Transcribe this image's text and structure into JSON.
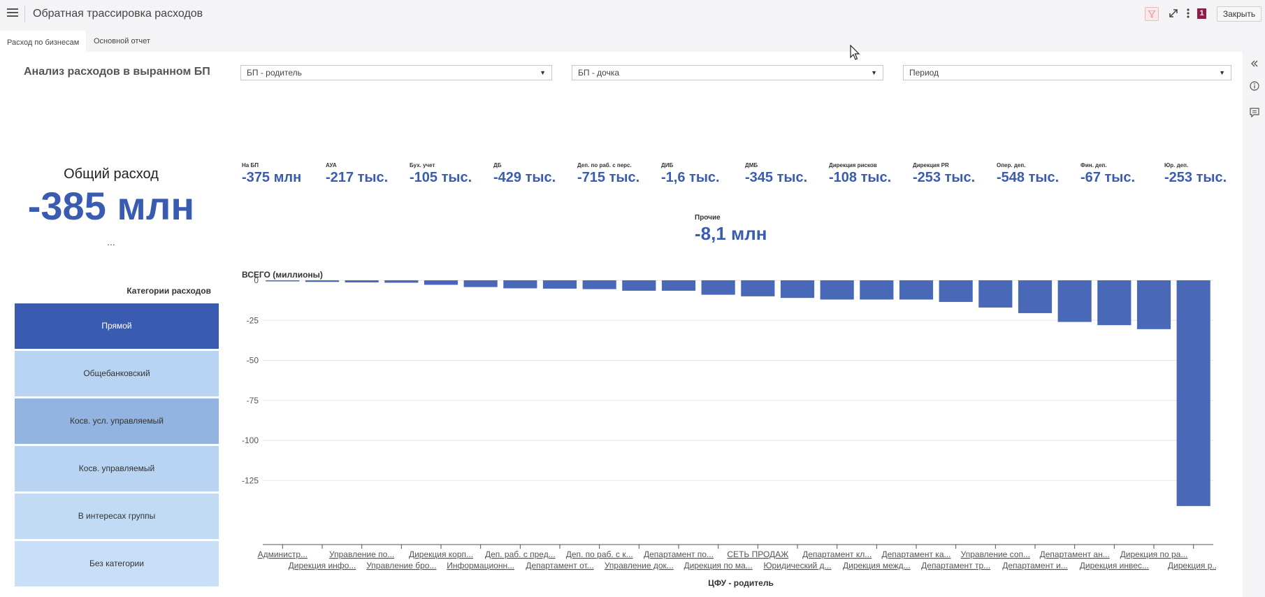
{
  "app": {
    "title": "Обратная трассировка расходов",
    "close_label": "Закрыть",
    "badge_count": "1",
    "filter_color": "#e08b8b"
  },
  "tabs": [
    {
      "label": "Расход по бизнесам",
      "active": true
    },
    {
      "label": "Основной отчет",
      "active": false
    }
  ],
  "header": {
    "section_title": "Анализ расходов в выранном БП"
  },
  "filters": [
    {
      "label": "БП - родитель"
    },
    {
      "label": "БП - дочка"
    },
    {
      "label": "Период"
    }
  ],
  "total": {
    "label": "Общий расход",
    "value": "-385 млн",
    "more": "..."
  },
  "kpis": [
    {
      "label": "На БП",
      "value": "-375 млн"
    },
    {
      "label": "АУА",
      "value": "-217 тыс."
    },
    {
      "label": "Бух. учет",
      "value": "-105 тыс."
    },
    {
      "label": "ДБ",
      "value": "-429 тыс."
    },
    {
      "label": "Деп. по раб. с перс.",
      "value": "-715 тыс."
    },
    {
      "label": "ДИБ",
      "value": "-1,6 тыс."
    },
    {
      "label": "ДМБ",
      "value": "-345 тыс."
    },
    {
      "label": "Дирекция рисков",
      "value": "-108 тыс."
    },
    {
      "label": "Дирекция PR",
      "value": "-253 тыс."
    },
    {
      "label": "Опер. деп.",
      "value": "-548 тыс."
    },
    {
      "label": "Фин. деп.",
      "value": "-67 тыс."
    },
    {
      "label": "Юр. деп.",
      "value": "-253 тыс."
    }
  ],
  "kpi_other": {
    "label": "Прочие",
    "value": "-8,1 млн"
  },
  "categories": {
    "title": "Категории расходов",
    "items": [
      {
        "label": "Прямой",
        "color": "#3a5cb0",
        "text_color": "#ffffff"
      },
      {
        "label": "Общебанковский",
        "color": "#b9d4f2",
        "text_color": "#333333"
      },
      {
        "label": "Косв. усл. управляемый",
        "color": "#93b3e0",
        "text_color": "#333333"
      },
      {
        "label": "Косв. управляемый",
        "color": "#b9d4f2",
        "text_color": "#333333"
      },
      {
        "label": "В интересах группы",
        "color": "#c2dbf5",
        "text_color": "#333333"
      },
      {
        "label": "Без категории",
        "color": "#c8e0f7",
        "text_color": "#333333"
      }
    ]
  },
  "chart_data": {
    "type": "bar",
    "title": "ВСЕГО (миллионы)",
    "xlabel": "ЦФУ - родитель",
    "ylabel": "",
    "ylim": [
      -142,
      0
    ],
    "yticks": [
      0,
      -25,
      -50,
      -75,
      -100,
      -125
    ],
    "bar_color": "#4a68b8",
    "categories": [
      "Администр...",
      "Дирекция инфо...",
      "Управление по...",
      "Управление бро...",
      "Дирекция корп...",
      "Информационн...",
      "Деп. раб. с пред...",
      "Департамент от...",
      "Деп. по раб. с к...",
      "Управление док...",
      "Департамент по...",
      "Дирекция по ма...",
      "СЕТЬ ПРОДАЖ",
      "Юридический д...",
      "Департамент кл...",
      "Дирекция межд...",
      "Департамент ка...",
      "Департамент тр...",
      "Управление соп...",
      "Департамент и...",
      "Департамент ан...",
      "Дирекция инвес...",
      "Дирекция по ра...",
      "Дирекция р..."
    ],
    "values": [
      -0.5,
      -1.0,
      -1.3,
      -1.5,
      -2.8,
      -4.2,
      -5.0,
      -5.2,
      -5.5,
      -6.5,
      -6.5,
      -9.0,
      -10.0,
      -11.0,
      -12.0,
      -12.0,
      -12.0,
      -13.5,
      -17.0,
      -20.5,
      -26.0,
      -28.0,
      -30.5,
      -141.0
    ]
  }
}
